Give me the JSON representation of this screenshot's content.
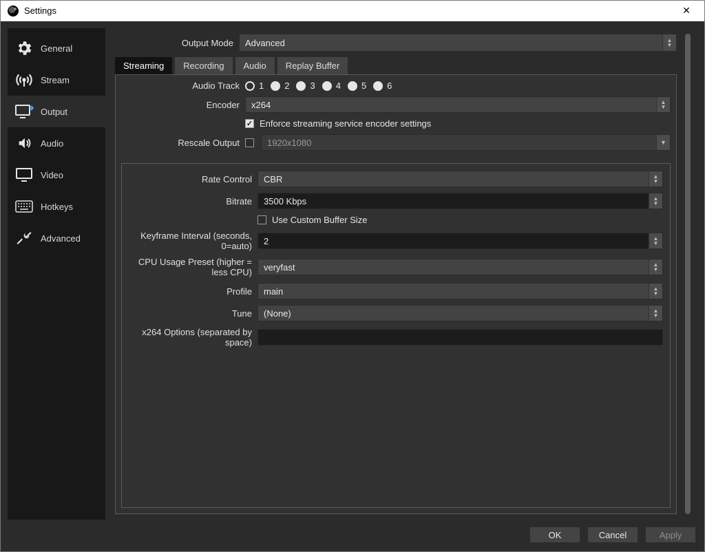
{
  "window": {
    "title": "Settings"
  },
  "sidebar": {
    "items": [
      {
        "label": "General"
      },
      {
        "label": "Stream"
      },
      {
        "label": "Output"
      },
      {
        "label": "Audio"
      },
      {
        "label": "Video"
      },
      {
        "label": "Hotkeys"
      },
      {
        "label": "Advanced"
      }
    ],
    "active_index": 2
  },
  "output_mode": {
    "label": "Output Mode",
    "value": "Advanced"
  },
  "tabs": {
    "items": [
      {
        "label": "Streaming"
      },
      {
        "label": "Recording"
      },
      {
        "label": "Audio"
      },
      {
        "label": "Replay Buffer"
      }
    ],
    "active_index": 0
  },
  "streaming": {
    "audio_track": {
      "label": "Audio Track",
      "options": [
        "1",
        "2",
        "3",
        "4",
        "5",
        "6"
      ],
      "selected": "1"
    },
    "encoder": {
      "label": "Encoder",
      "value": "x264"
    },
    "enforce": {
      "label": "Enforce streaming service encoder settings",
      "checked": true
    },
    "rescale": {
      "label": "Rescale Output",
      "checked": false,
      "value": "1920x1080"
    },
    "rate_control": {
      "label": "Rate Control",
      "value": "CBR"
    },
    "bitrate": {
      "label": "Bitrate",
      "value": "3500 Kbps"
    },
    "custom_buffer": {
      "label": "Use Custom Buffer Size",
      "checked": false
    },
    "keyframe": {
      "label": "Keyframe Interval (seconds, 0=auto)",
      "value": "2"
    },
    "cpu_preset": {
      "label": "CPU Usage Preset (higher = less CPU)",
      "value": "veryfast"
    },
    "profile": {
      "label": "Profile",
      "value": "main"
    },
    "tune": {
      "label": "Tune",
      "value": "(None)"
    },
    "x264_opts": {
      "label": "x264 Options (separated by space)",
      "value": ""
    }
  },
  "footer": {
    "ok": "OK",
    "cancel": "Cancel",
    "apply": "Apply"
  }
}
